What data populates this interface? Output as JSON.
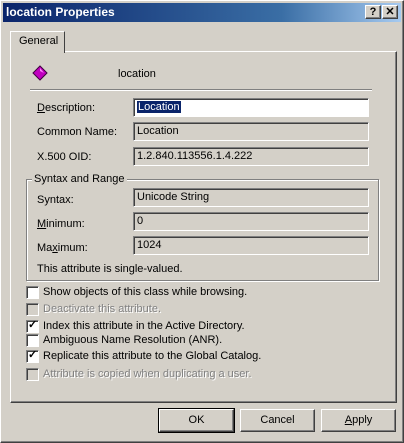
{
  "window": {
    "title": "location Properties",
    "help_btn": "?",
    "close_btn": "✕"
  },
  "tabs": [
    {
      "label": "General"
    }
  ],
  "object": {
    "name": "location",
    "icon": "attribute-diamond-icon",
    "icon_color": "#c000c0"
  },
  "fields": {
    "description": {
      "label": "Description:",
      "accel": "D",
      "rest": "escription:",
      "value": "Location"
    },
    "common_name": {
      "label": "Common Name:",
      "value": "Location"
    },
    "x500_oid": {
      "label": "X.500 OID:",
      "value": "1.2.840.113556.1.4.222"
    }
  },
  "syntax_group": {
    "title": "Syntax and Range",
    "syntax": {
      "label": "Syntax:",
      "value": "Unicode String"
    },
    "minimum": {
      "label": "Minimum:",
      "accel": "M",
      "rest": "inimum:",
      "value": "0"
    },
    "maximum": {
      "label": "Maximum:",
      "pre": "Ma",
      "accel": "x",
      "rest": "imum:",
      "value": "1024"
    },
    "note": "This attribute is single-valued."
  },
  "options": [
    {
      "label": "Show objects of this class while browsing.",
      "checked": false,
      "enabled": true
    },
    {
      "label": "Deactivate this attribute.",
      "checked": false,
      "enabled": false
    },
    {
      "label": "Index this attribute in the Active Directory.",
      "checked": true,
      "enabled": true
    },
    {
      "label": "Ambiguous Name Resolution (ANR).",
      "checked": false,
      "enabled": true
    },
    {
      "label": "Replicate this attribute to the Global Catalog.",
      "checked": true,
      "enabled": true
    },
    {
      "label": "Attribute is copied when duplicating a user.",
      "checked": false,
      "enabled": false
    }
  ],
  "buttons": {
    "ok": "OK",
    "cancel": "Cancel",
    "apply": "Apply"
  }
}
